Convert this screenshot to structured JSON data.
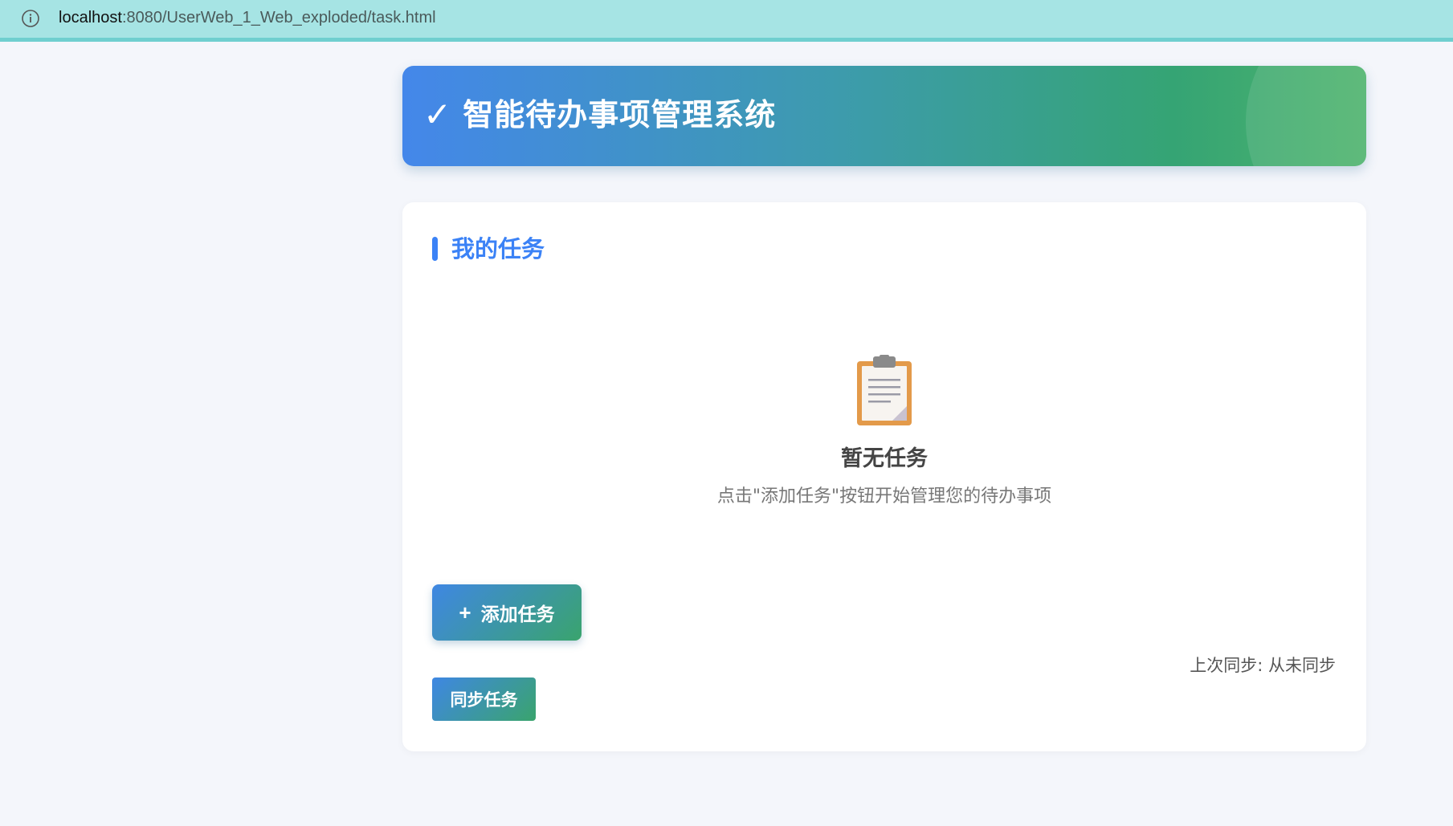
{
  "browser": {
    "url_host": "localhost",
    "url_rest": ":8080/UserWeb_1_Web_exploded/task.html",
    "info_icon": "info-icon"
  },
  "header": {
    "check_glyph": "✓",
    "title": "智能待办事项管理系统"
  },
  "tasks": {
    "section_title": "我的任务",
    "empty_icon": "clipboard-icon",
    "empty_title": "暂无任务",
    "empty_desc": "点击\"添加任务\"按钮开始管理您的待办事项",
    "add_plus": "+",
    "add_label": "添加任务",
    "sync_label": "同步任务",
    "last_sync": "上次同步: 从未同步"
  },
  "colors": {
    "accent_blue": "#3b82f6",
    "accent_green": "#35a474",
    "addressbar": "#a6e4e4",
    "clipboard_orange": "#e39a4a"
  }
}
